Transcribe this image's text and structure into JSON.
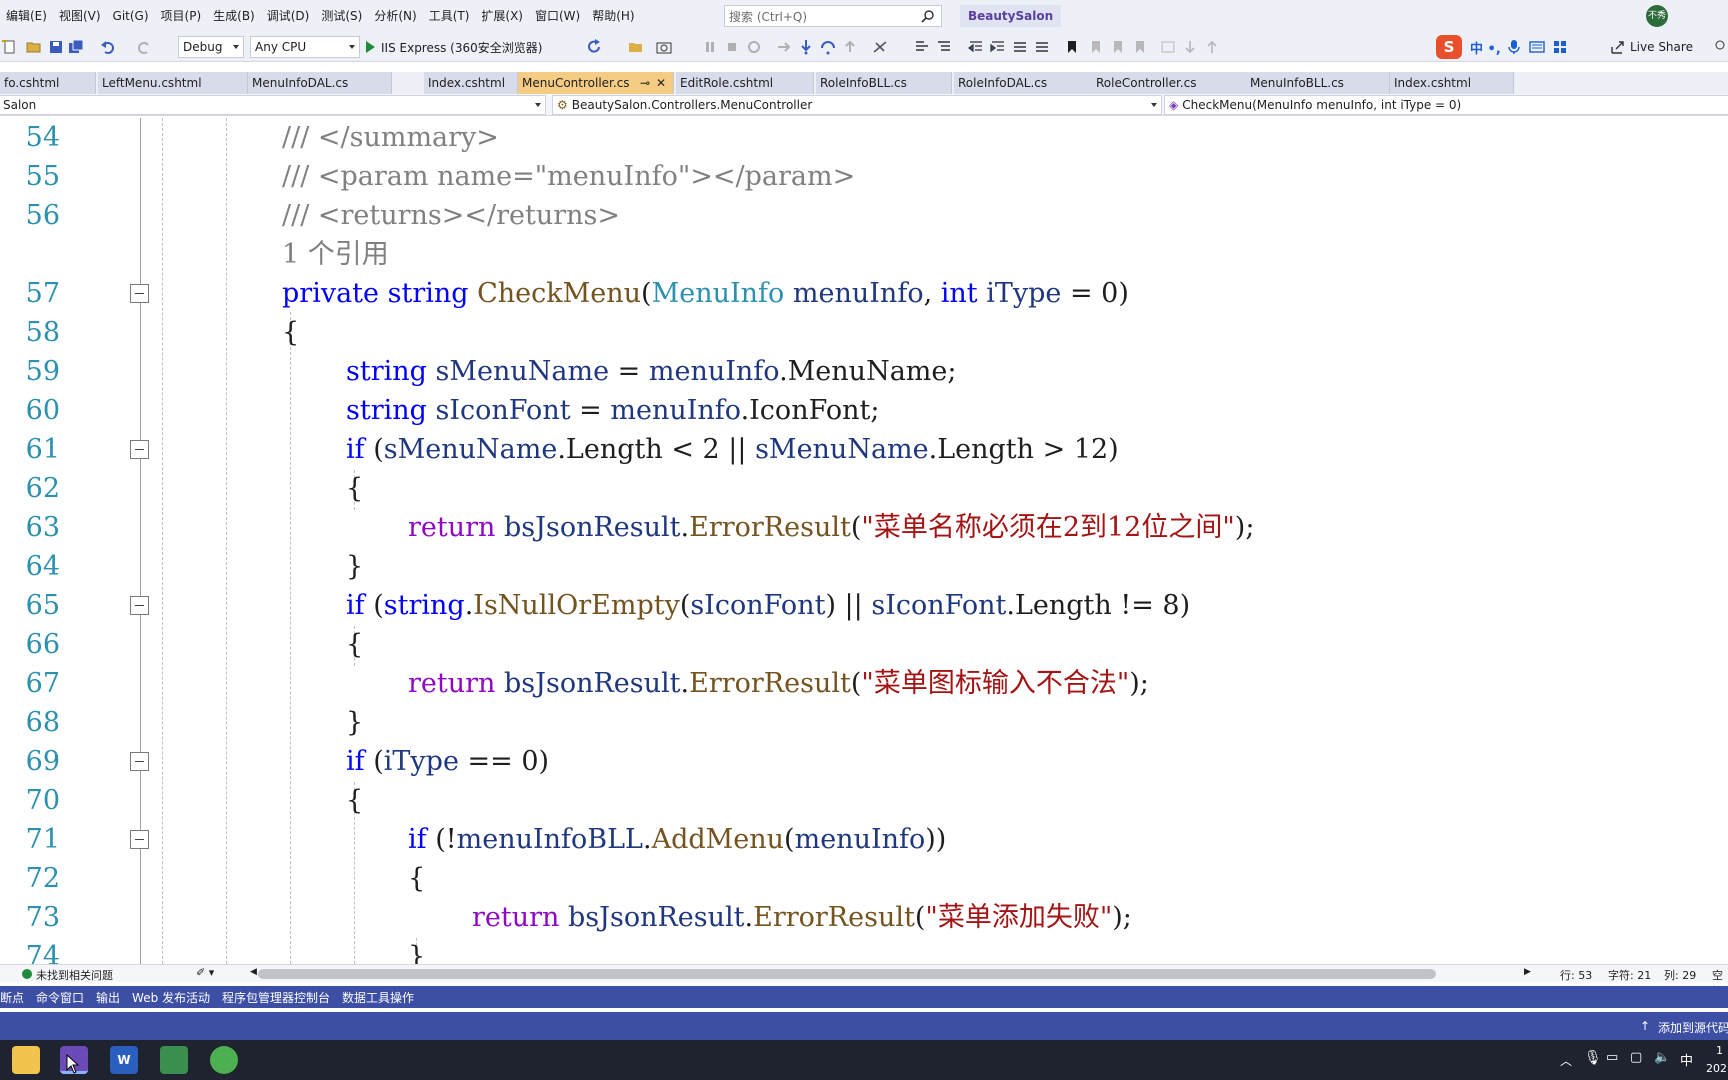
{
  "menubar": {
    "items": [
      "编辑(E)",
      "视图(V)",
      "Git(G)",
      "项目(P)",
      "生成(B)",
      "调试(D)",
      "测试(S)",
      "分析(N)",
      "工具(T)",
      "扩展(X)",
      "窗口(W)",
      "帮助(H)"
    ],
    "search_placeholder": "搜索 (Ctrl+Q)",
    "solution_name": "BeautySalon",
    "avatar_text": "不秀"
  },
  "toolbar": {
    "configuration": "Debug",
    "platform": "Any CPU",
    "run_target": "IIS Express (360安全浏览器)",
    "ime_chars": "中 •, ",
    "live_share": "Live Share"
  },
  "tabs": [
    {
      "label": "fo.cshtml",
      "active": false
    },
    {
      "label": "LeftMenu.cshtml",
      "active": false
    },
    {
      "label": "MenuInfoDAL.cs",
      "active": false
    },
    {
      "label": "Index.cshtml",
      "active": false
    },
    {
      "label": "MenuController.cs",
      "active": true
    },
    {
      "label": "EditRole.cshtml",
      "active": false
    },
    {
      "label": "RoleInfoBLL.cs",
      "active": false
    },
    {
      "label": "RoleInfoDAL.cs",
      "active": false
    },
    {
      "label": "RoleController.cs",
      "active": false
    },
    {
      "label": "MenuInfoBLL.cs",
      "active": false
    },
    {
      "label": "Index.cshtml",
      "active": false
    }
  ],
  "navbar": {
    "project": "Salon",
    "class": "BeautySalon.Controllers.MenuController",
    "member": "CheckMenu(MenuInfo menuInfo, int iType = 0)"
  },
  "code": {
    "lines": [
      {
        "num": "54",
        "text": "/// </summary>"
      },
      {
        "num": "55",
        "text": "/// <param name=\"menuInfo\"></param>"
      },
      {
        "num": "56",
        "text": "/// <returns></returns>"
      },
      {
        "num": "",
        "text": "1 个引用"
      },
      {
        "num": "57",
        "text": "private string CheckMenu(MenuInfo menuInfo, int iType = 0)"
      },
      {
        "num": "58",
        "text": "{"
      },
      {
        "num": "59",
        "text": "string sMenuName = menuInfo.MenuName;"
      },
      {
        "num": "60",
        "text": "string sIconFont = menuInfo.IconFont;"
      },
      {
        "num": "61",
        "text": "if (sMenuName.Length < 2 || sMenuName.Length > 12)"
      },
      {
        "num": "62",
        "text": "{"
      },
      {
        "num": "63",
        "text": "return bsJsonResult.ErrorResult(\"菜单名称必须在2到12位之间\");"
      },
      {
        "num": "64",
        "text": "}"
      },
      {
        "num": "65",
        "text": "if (string.IsNullOrEmpty(sIconFont) || sIconFont.Length != 8)"
      },
      {
        "num": "66",
        "text": "{"
      },
      {
        "num": "67",
        "text": "return bsJsonResult.ErrorResult(\"菜单图标输入不合法\");"
      },
      {
        "num": "68",
        "text": "}"
      },
      {
        "num": "69",
        "text": "if (iType == 0)"
      },
      {
        "num": "70",
        "text": "{"
      },
      {
        "num": "71",
        "text": "if (!menuInfoBLL.AddMenu(menuInfo))"
      },
      {
        "num": "72",
        "text": "{"
      },
      {
        "num": "73",
        "text": "return bsJsonResult.ErrorResult(\"菜单添加失败\");"
      },
      {
        "num": "74",
        "text": "}"
      }
    ]
  },
  "editor_status": {
    "issues": "未找到相关问题",
    "line": "行: 53",
    "char": "字符: 21",
    "col": "列: 29",
    "mode": "空格"
  },
  "toolwindows": [
    "断点",
    "命令窗口",
    "输出",
    "Web 发布活动",
    "程序包管理器控制台",
    "数据工具操作"
  ],
  "statusbar": {
    "add_source": "添加到源代码"
  },
  "taskbar": {
    "clock_time": "1",
    "clock_date": "202",
    "ime_lang": "中"
  }
}
